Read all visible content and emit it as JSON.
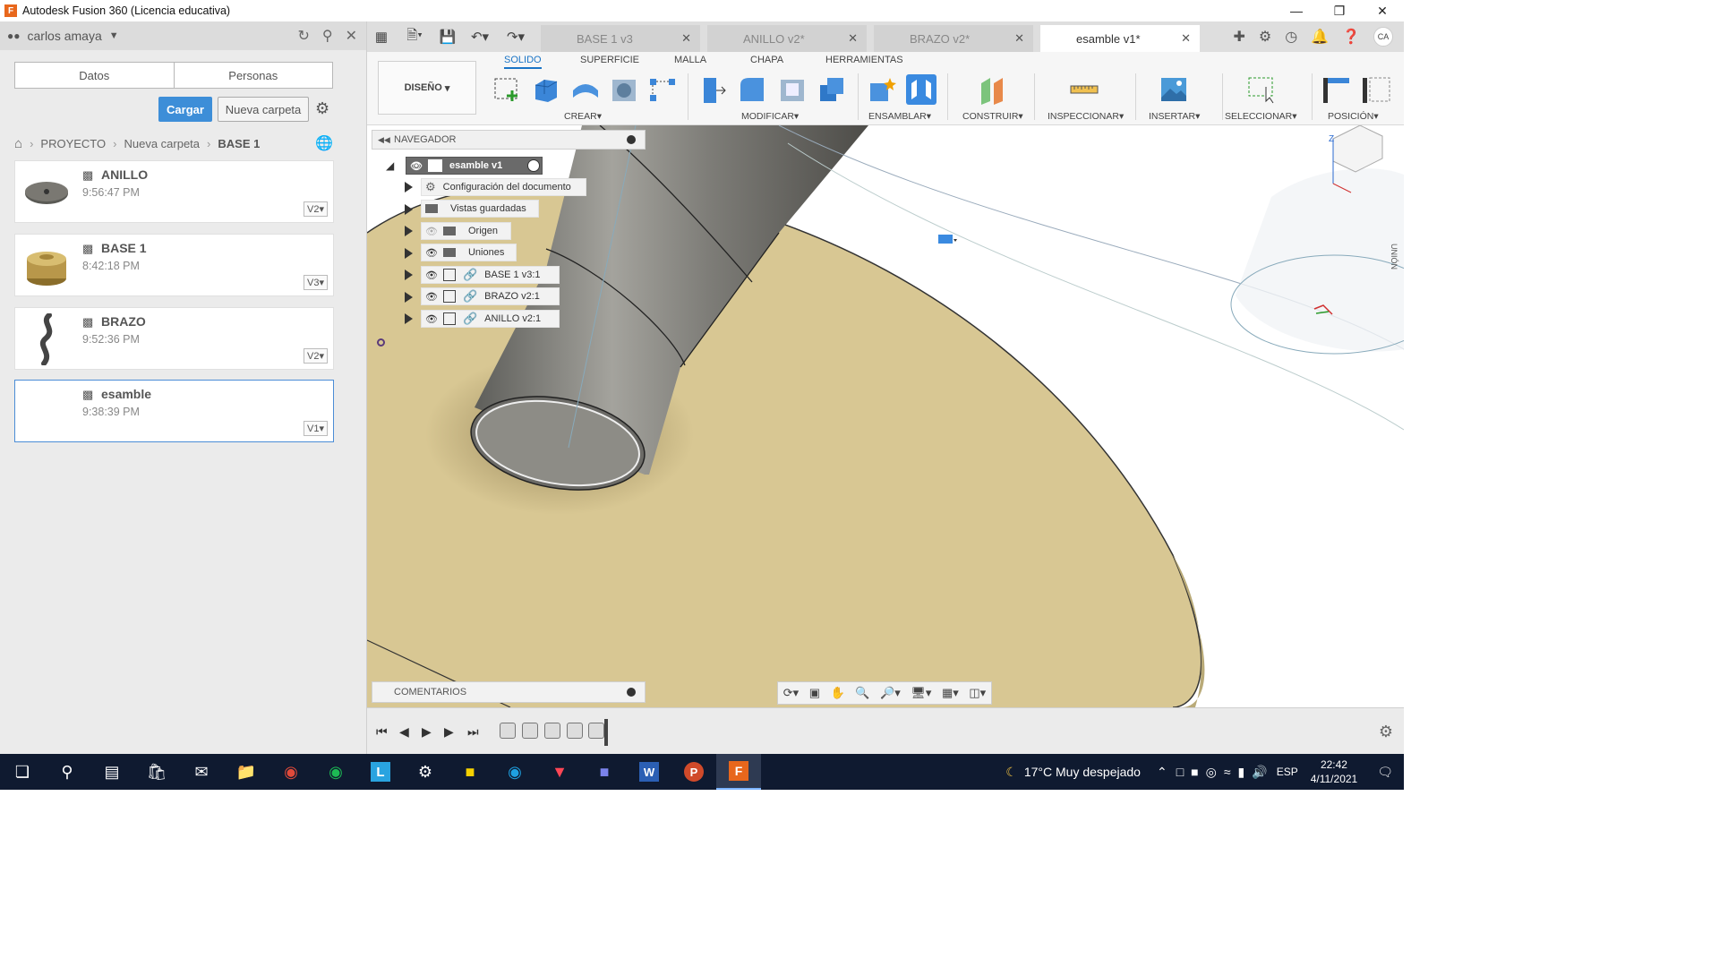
{
  "window": {
    "title": "Autodesk Fusion 360 (Licencia educativa)",
    "app_icon": "F"
  },
  "panel": {
    "user": "carlos amaya",
    "tabs": [
      "Datos",
      "Personas"
    ],
    "buttons": {
      "upload": "Cargar",
      "new_folder": "Nueva carpeta"
    },
    "breadcrumb": [
      "PROYECTO",
      "Nueva carpeta",
      "BASE 1"
    ],
    "files": [
      {
        "name": "ANILLO",
        "time": "9:56:47 PM",
        "version": "V2"
      },
      {
        "name": "BASE 1",
        "time": "8:42:18 PM",
        "version": "V3"
      },
      {
        "name": "BRAZO",
        "time": "9:52:36 PM",
        "version": "V2"
      },
      {
        "name": "esamble",
        "time": "9:38:39 PM",
        "version": "V1"
      }
    ]
  },
  "doc_tabs": [
    {
      "label": "BASE 1 v3"
    },
    {
      "label": "ANILLO v2*"
    },
    {
      "label": "BRAZO v2*"
    },
    {
      "label": "esamble v1*"
    }
  ],
  "toolbar": {
    "workspace": "DISEÑO",
    "tabs": [
      "SOLIDO",
      "SUPERFICIE",
      "MALLA",
      "CHAPA",
      "HERRAMIENTAS"
    ],
    "groups": [
      "CREAR",
      "MODIFICAR",
      "ENSAMBLAR",
      "CONSTRUIR",
      "INSPECCIONAR",
      "INSERTAR",
      "SELECCIONAR",
      "POSICIÓN"
    ]
  },
  "browser": {
    "title": "NAVEGADOR",
    "root": "esamble v1",
    "items": [
      "Configuración del documento",
      "Vistas guardadas",
      "Origen",
      "Uniones",
      "BASE 1 v3:1",
      "BRAZO v2:1",
      "ANILLO v2:1"
    ]
  },
  "comments": {
    "title": "COMENTARIOS"
  },
  "viewcube": {
    "side_label": "UNIÓN",
    "axis_label": "Z"
  },
  "avatar": "CA",
  "taskbar": {
    "weather": "17°C  Muy despejado",
    "lang": "ESP",
    "time": "22:42",
    "date": "4/11/2021"
  }
}
